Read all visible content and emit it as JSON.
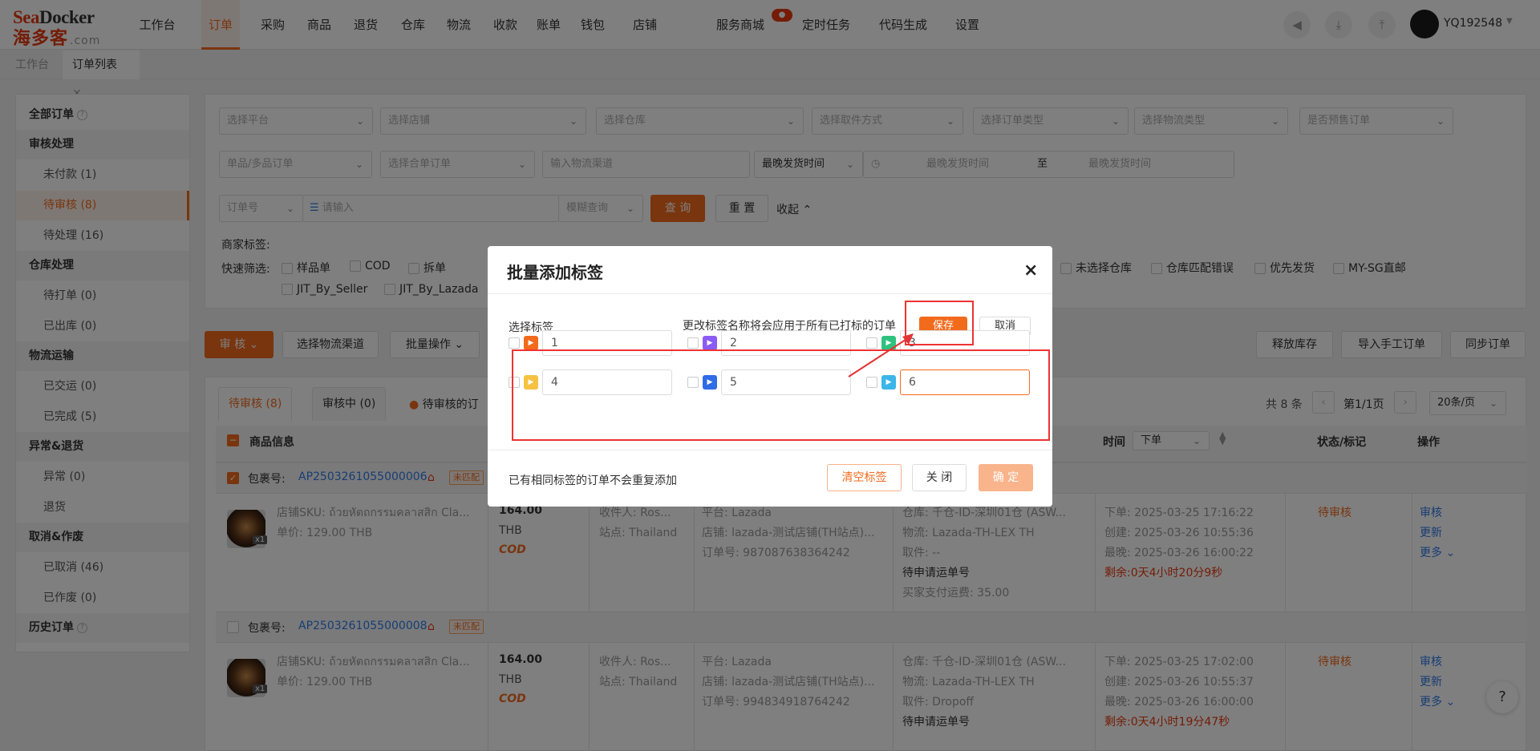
{
  "logo": {
    "brand_a": "Sea",
    "brand_b": "Docker",
    "cn": "海多客",
    "domain": ".com"
  },
  "nav": [
    "工作台",
    "订单",
    "采购",
    "商品",
    "退货",
    "仓库",
    "物流",
    "收款",
    "账单",
    "钱包",
    "店铺",
    "服务商城",
    "定时任务",
    "代码生成",
    "设置"
  ],
  "nav_badge": "●",
  "user": {
    "name": "YQ192548"
  },
  "tabs": {
    "home": "工作台",
    "orders": "订单列表"
  },
  "sidebar": {
    "all": "全部订单",
    "g1": "审核处理",
    "g1_items": [
      "未付款 (1)",
      "待审核 (8)",
      "待处理 (16)"
    ],
    "g2": "仓库处理",
    "g2_items": [
      "待打单 (0)",
      "已出库 (0)"
    ],
    "g3": "物流运输",
    "g3_items": [
      "已交运 (0)",
      "已完成 (5)"
    ],
    "g4": "异常&退货",
    "g4_items": [
      "异常 (0)",
      "退货"
    ],
    "g5": "取消&作废",
    "g5_items": [
      "已取消 (46)",
      "已作废 (0)"
    ],
    "history": "历史订单"
  },
  "filters": {
    "row1": [
      "选择平台",
      "选择店铺",
      "选择仓库",
      "选择取件方式",
      "选择订单类型",
      "选择物流类型",
      "是否预售订单"
    ],
    "row2": [
      "单品/多品订单",
      "选择合单订单",
      "输入物流渠道",
      "最晚发货时间"
    ],
    "date_start": "最晚发货时间",
    "date_to": "至",
    "date_end": "最晚发货时间",
    "order_no": "订单号",
    "search_placeholder": "请输入",
    "fuzzy": "模糊查询",
    "query": "查 询",
    "reset": "重 置",
    "collapse": "收起",
    "merchant_tags": "商家标签:",
    "quick": "快速筛选:",
    "quick_items": [
      "样品单",
      "COD",
      "拆单"
    ],
    "quick_right": [
      "未选择仓库",
      "仓库匹配错误",
      "优先发货",
      "MY-SG直邮"
    ],
    "quick_row2": [
      "JIT_By_Seller",
      "JIT_By_Lazada"
    ]
  },
  "actions": {
    "audit": "审 核",
    "select_channel": "选择物流渠道",
    "batch": "批量操作",
    "release": "释放库存",
    "import": "导入手工订单",
    "sync": "同步订单"
  },
  "list": {
    "tab_pending": "待审核 (8)",
    "tab_auditing": "审核中 (0)",
    "tip": "待审核的订",
    "total": "共 8 条",
    "page": "第1/1页",
    "per_page": "20条/页",
    "col_goods": "商品信息",
    "col_time": "时间",
    "time_sel": "下单",
    "col_status": "状态/标记",
    "col_op": "操作",
    "pkg_label": "包裹号:",
    "unmatched": "未匹配",
    "orders": [
      {
        "pkg": "AP2503261055000006",
        "sku": "店铺SKU: ถ้วยหัตถกรรมคลาสสิก Cla...",
        "price": "单价: 129.00 THB",
        "qty": "x1",
        "amount": "164.00",
        "cur": "THB",
        "cod": "COD",
        "recv": "收件人: Ros...",
        "site": "站点: Thailand",
        "platform": "平台: Lazada",
        "store": "店铺: lazada-测试店铺(TH站点)...",
        "ono": "订单号: 987087638364242",
        "wh": "仓库: 千仓-ID-深圳01仓 (ASW...",
        "logi": "物流: Lazada-TH-LEX TH",
        "pick": "取件: --",
        "pend": "待申请运单号",
        "fee": "买家支付运费: 35.00",
        "t1": "下单: 2025-03-25 17:16:22",
        "t2": "创建: 2025-03-26 10:55:36",
        "t3": "最晚: 2025-03-26 16:00:22",
        "left_l": "剩余:",
        "left_v": "0天4小时20分9秒",
        "status": "待审核",
        "op1": "审核",
        "op2": "更新",
        "op3": "更多"
      },
      {
        "pkg": "AP2503261055000008",
        "sku": "店铺SKU: ถ้วยหัตถกรรมคลาสสิก Cla...",
        "price": "单价: 129.00 THB",
        "qty": "x1",
        "amount": "164.00",
        "cur": "THB",
        "cod": "COD",
        "recv": "收件人: Ros...",
        "site": "站点: Thailand",
        "platform": "平台: Lazada",
        "store": "店铺: lazada-测试店铺(TH站点)...",
        "ono": "订单号: 994834918764242",
        "wh": "仓库: 千仓-ID-深圳01仓 (ASW...",
        "logi": "物流: Lazada-TH-LEX TH",
        "pick": "取件: Dropoff",
        "pend": "待申请运单号",
        "t1": "下单: 2025-03-25 17:02:00",
        "t2": "创建: 2025-03-26 10:55:37",
        "t3": "最晚: 2025-03-26 16:00:00",
        "left_l": "剩余:",
        "left_v": "0天4小时19分47秒",
        "status": "待审核",
        "op1": "审核",
        "op2": "更新",
        "op3": "更多"
      }
    ]
  },
  "help": "?",
  "modal": {
    "title": "批量添加标签",
    "close": "×",
    "select_label": "选择标签",
    "hint": "更改标签名称将会应用于所有已打标的订单",
    "save": "保存",
    "cancel": "取消",
    "tags": [
      "1",
      "2",
      "3",
      "4",
      "5",
      "6"
    ],
    "tag_colors": [
      "#f26b1d",
      "#8a5cf5",
      "#2ec27e",
      "#f5c242",
      "#2f6ce6",
      "#3cb6e8"
    ],
    "footer_note": "已有相同标签的订单不会重复添加",
    "clear": "清空标签",
    "close_btn": "关 闭",
    "confirm": "确 定"
  },
  "colors": {
    "accent": "#f26b1d",
    "annotation": "#e33333"
  }
}
